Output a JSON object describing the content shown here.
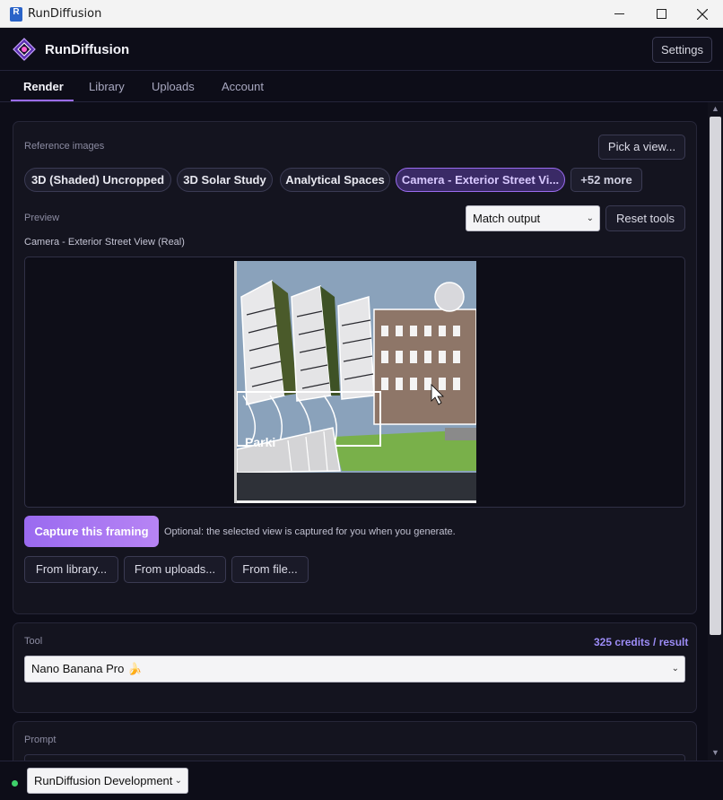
{
  "window": {
    "title": "RunDiffusion",
    "icon_letter": "R"
  },
  "header": {
    "brand": "RunDiffusion",
    "settings_label": "Settings"
  },
  "tabs": [
    "Render",
    "Library",
    "Uploads",
    "Account"
  ],
  "reference": {
    "label": "Reference images",
    "pick_view_label": "Pick a view...",
    "chips": [
      "3D (Shaded) Uncropped",
      "3D Solar Study",
      "Analytical Spaces",
      "Camera - Exterior Street Vi..."
    ],
    "more_label": "+52 more",
    "preview_label": "Preview",
    "match_output_value": "Match output",
    "reset_tools_label": "Reset tools",
    "view_name": "Camera - Exterior Street View (Real)",
    "preview_sign_text": "Parki",
    "capture_label": "Capture this framing",
    "capture_hint": "Optional: the selected view is captured for you when you generate.",
    "from_library": "From library...",
    "from_uploads": "From uploads...",
    "from_file": "From file..."
  },
  "tool": {
    "label": "Tool",
    "credits": "325 credits / result",
    "selected": "Nano Banana Pro 🍌"
  },
  "prompt": {
    "label": "Prompt"
  },
  "footer": {
    "environment": "RunDiffusion Development"
  },
  "colors": {
    "accent": "#9b6cf0",
    "credits": "#9c8cf6",
    "status": "#3ed06a"
  }
}
